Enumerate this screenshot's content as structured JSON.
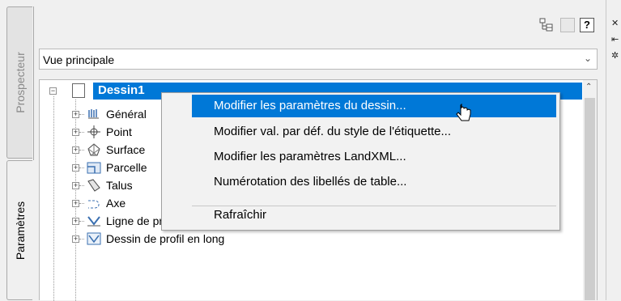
{
  "tabs": [
    {
      "label": "Prospecteur",
      "active": false
    },
    {
      "label": "Paramètres",
      "active": true
    }
  ],
  "toolbar": {
    "help_label": "?",
    "icons": [
      "settings-tree-icon",
      "window-icon",
      "help-icon"
    ]
  },
  "view_select": {
    "value": "Vue principale"
  },
  "tree": {
    "root": "Dessin1",
    "items": [
      {
        "label": "Général",
        "icon": "general-icon"
      },
      {
        "label": "Point",
        "icon": "point-icon"
      },
      {
        "label": "Surface",
        "icon": "surface-icon"
      },
      {
        "label": "Parcelle",
        "icon": "parcel-icon"
      },
      {
        "label": "Talus",
        "icon": "grading-icon"
      },
      {
        "label": "Axe",
        "icon": "alignment-icon"
      },
      {
        "label": "Ligne de profil en long",
        "icon": "profile-icon"
      },
      {
        "label": "Dessin de profil en long",
        "icon": "profile-view-icon"
      }
    ]
  },
  "context_menu": {
    "items": [
      "Modifier les paramètres du dessin...",
      "Modifier val. par déf. du style de l'étiquette...",
      "Modifier les paramètres LandXML...",
      "Numérotation des libellés de table...",
      "Rafraîchir"
    ],
    "highlighted_index": 0
  },
  "colors": {
    "selection": "#0078d7",
    "panel_bg": "#f0f0f0"
  }
}
